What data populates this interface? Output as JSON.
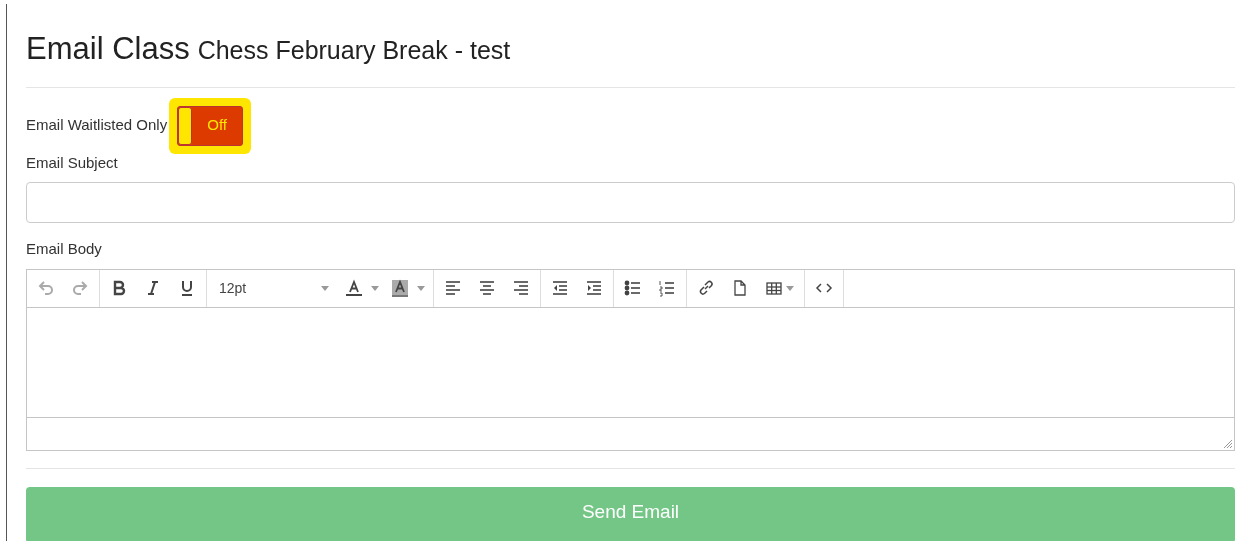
{
  "heading": {
    "title": "Email Class",
    "subtitle": "Chess February Break - test"
  },
  "waitlist_toggle": {
    "label": "Email Waitlisted Only",
    "on": false,
    "off_text": "Off",
    "highlighted": true
  },
  "subject": {
    "label": "Email Subject"
  },
  "body": {
    "label": "Email Body",
    "toolbar": [
      [
        {
          "kind": "undo",
          "disabled": true
        },
        {
          "kind": "redo",
          "disabled": true
        }
      ],
      [
        {
          "kind": "bold",
          "disabled": false
        },
        {
          "kind": "italic",
          "disabled": false
        },
        {
          "kind": "underline",
          "disabled": false
        }
      ],
      [
        {
          "kind": "font-size",
          "disabled": false,
          "value": "12pt"
        },
        {
          "kind": "text-color",
          "disabled": false
        },
        {
          "kind": "background-color",
          "disabled": false
        }
      ],
      [
        {
          "kind": "align-left",
          "disabled": false
        },
        {
          "kind": "align-center",
          "disabled": false
        },
        {
          "kind": "align-right",
          "disabled": false
        }
      ],
      [
        {
          "kind": "outdent",
          "disabled": false
        },
        {
          "kind": "indent",
          "disabled": false
        }
      ],
      [
        {
          "kind": "bullet-list",
          "disabled": false
        },
        {
          "kind": "numbered-list",
          "disabled": false
        }
      ],
      [
        {
          "kind": "link",
          "disabled": false
        },
        {
          "kind": "document",
          "disabled": false
        },
        {
          "kind": "table",
          "disabled": false
        }
      ],
      [
        {
          "kind": "code",
          "disabled": false
        }
      ]
    ]
  },
  "send_button": {
    "label": "Send Email"
  }
}
